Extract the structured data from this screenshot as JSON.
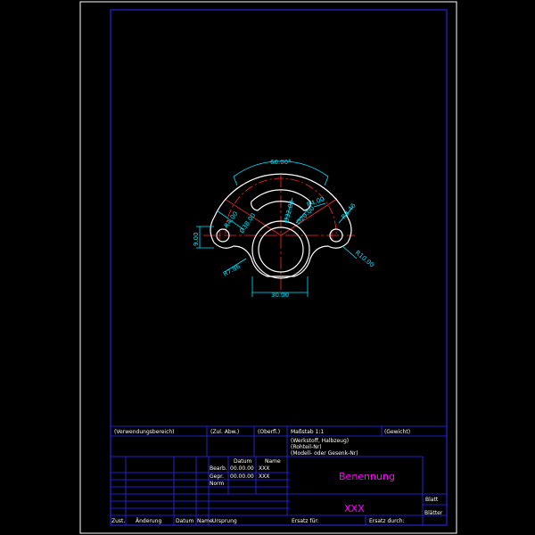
{
  "colors": {
    "background": "#000000",
    "frame_outer": "#ffffff",
    "frame_inner": "#2b2bff",
    "part": "#ffffff",
    "centerline": "#ff2a2a",
    "dimension": "#00e5ff",
    "title_text": "#ffffff",
    "title_accent": "#ff00ff"
  },
  "drawing": {
    "dimensions": {
      "top_width": "60.00°",
      "bottom_width": "30.00",
      "left_height": "9.00",
      "radius_arc": "R4.00",
      "radius_left_hole": "R4.00",
      "arc_left": "Ø38.00",
      "arc_mid": "Ø32.00",
      "hole_center": "Ø20.00",
      "radius_right": "R3.46",
      "radius_bottom_right": "R10.00",
      "radius_bottom_left": "R7.86"
    }
  },
  "title_block": {
    "verwendungsbereich": "(Verwendungsbereich)",
    "zul_abw": "(Zul. Abw.)",
    "oberfl": "(Oberfl.)",
    "massstab": "Maßstab  1:1",
    "gewicht": "(Gewicht)",
    "werkstoff": "(Werkstoff, Halbzeug)",
    "rohteil": "(Rohteil-Nr)",
    "modell": "(Modell- oder Gesenk-Nr)",
    "datum_header": "Datum",
    "name_header": "Name",
    "bearb_label": "Bearb.",
    "bearb_date": "00.00.00",
    "bearb_name": "XXX",
    "gepr_label": "Gepr.",
    "gepr_date": "00.00.00",
    "gepr_name": "XXX",
    "norm_label": "Norm",
    "benennung": "Benennung",
    "zeichnungsnummer": "XXX",
    "blatt": "Blatt",
    "blaetter": "Blätter",
    "zust": "Zust.",
    "aenderung": "Änderung",
    "datum_footer": "Datum",
    "name_footer": "Name",
    "ursprung": "Ursprung",
    "ersatz_fuer": "Ersatz für:",
    "ersatz_durch": "Ersatz durch:"
  }
}
